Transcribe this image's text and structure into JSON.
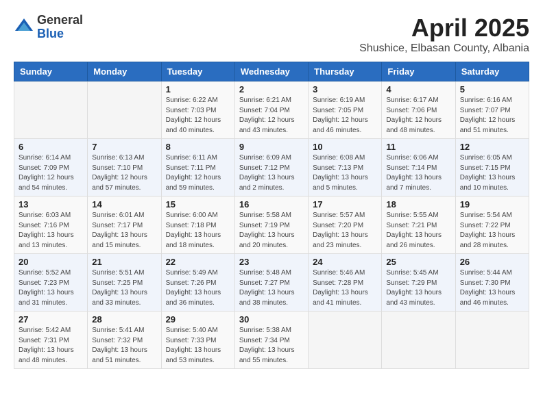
{
  "header": {
    "logo_general": "General",
    "logo_blue": "Blue",
    "month": "April 2025",
    "location": "Shushice, Elbasan County, Albania"
  },
  "weekdays": [
    "Sunday",
    "Monday",
    "Tuesday",
    "Wednesday",
    "Thursday",
    "Friday",
    "Saturday"
  ],
  "weeks": [
    [
      {
        "day": "",
        "info": ""
      },
      {
        "day": "",
        "info": ""
      },
      {
        "day": "1",
        "info": "Sunrise: 6:22 AM\nSunset: 7:03 PM\nDaylight: 12 hours and 40 minutes."
      },
      {
        "day": "2",
        "info": "Sunrise: 6:21 AM\nSunset: 7:04 PM\nDaylight: 12 hours and 43 minutes."
      },
      {
        "day": "3",
        "info": "Sunrise: 6:19 AM\nSunset: 7:05 PM\nDaylight: 12 hours and 46 minutes."
      },
      {
        "day": "4",
        "info": "Sunrise: 6:17 AM\nSunset: 7:06 PM\nDaylight: 12 hours and 48 minutes."
      },
      {
        "day": "5",
        "info": "Sunrise: 6:16 AM\nSunset: 7:07 PM\nDaylight: 12 hours and 51 minutes."
      }
    ],
    [
      {
        "day": "6",
        "info": "Sunrise: 6:14 AM\nSunset: 7:09 PM\nDaylight: 12 hours and 54 minutes."
      },
      {
        "day": "7",
        "info": "Sunrise: 6:13 AM\nSunset: 7:10 PM\nDaylight: 12 hours and 57 minutes."
      },
      {
        "day": "8",
        "info": "Sunrise: 6:11 AM\nSunset: 7:11 PM\nDaylight: 12 hours and 59 minutes."
      },
      {
        "day": "9",
        "info": "Sunrise: 6:09 AM\nSunset: 7:12 PM\nDaylight: 13 hours and 2 minutes."
      },
      {
        "day": "10",
        "info": "Sunrise: 6:08 AM\nSunset: 7:13 PM\nDaylight: 13 hours and 5 minutes."
      },
      {
        "day": "11",
        "info": "Sunrise: 6:06 AM\nSunset: 7:14 PM\nDaylight: 13 hours and 7 minutes."
      },
      {
        "day": "12",
        "info": "Sunrise: 6:05 AM\nSunset: 7:15 PM\nDaylight: 13 hours and 10 minutes."
      }
    ],
    [
      {
        "day": "13",
        "info": "Sunrise: 6:03 AM\nSunset: 7:16 PM\nDaylight: 13 hours and 13 minutes."
      },
      {
        "day": "14",
        "info": "Sunrise: 6:01 AM\nSunset: 7:17 PM\nDaylight: 13 hours and 15 minutes."
      },
      {
        "day": "15",
        "info": "Sunrise: 6:00 AM\nSunset: 7:18 PM\nDaylight: 13 hours and 18 minutes."
      },
      {
        "day": "16",
        "info": "Sunrise: 5:58 AM\nSunset: 7:19 PM\nDaylight: 13 hours and 20 minutes."
      },
      {
        "day": "17",
        "info": "Sunrise: 5:57 AM\nSunset: 7:20 PM\nDaylight: 13 hours and 23 minutes."
      },
      {
        "day": "18",
        "info": "Sunrise: 5:55 AM\nSunset: 7:21 PM\nDaylight: 13 hours and 26 minutes."
      },
      {
        "day": "19",
        "info": "Sunrise: 5:54 AM\nSunset: 7:22 PM\nDaylight: 13 hours and 28 minutes."
      }
    ],
    [
      {
        "day": "20",
        "info": "Sunrise: 5:52 AM\nSunset: 7:23 PM\nDaylight: 13 hours and 31 minutes."
      },
      {
        "day": "21",
        "info": "Sunrise: 5:51 AM\nSunset: 7:25 PM\nDaylight: 13 hours and 33 minutes."
      },
      {
        "day": "22",
        "info": "Sunrise: 5:49 AM\nSunset: 7:26 PM\nDaylight: 13 hours and 36 minutes."
      },
      {
        "day": "23",
        "info": "Sunrise: 5:48 AM\nSunset: 7:27 PM\nDaylight: 13 hours and 38 minutes."
      },
      {
        "day": "24",
        "info": "Sunrise: 5:46 AM\nSunset: 7:28 PM\nDaylight: 13 hours and 41 minutes."
      },
      {
        "day": "25",
        "info": "Sunrise: 5:45 AM\nSunset: 7:29 PM\nDaylight: 13 hours and 43 minutes."
      },
      {
        "day": "26",
        "info": "Sunrise: 5:44 AM\nSunset: 7:30 PM\nDaylight: 13 hours and 46 minutes."
      }
    ],
    [
      {
        "day": "27",
        "info": "Sunrise: 5:42 AM\nSunset: 7:31 PM\nDaylight: 13 hours and 48 minutes."
      },
      {
        "day": "28",
        "info": "Sunrise: 5:41 AM\nSunset: 7:32 PM\nDaylight: 13 hours and 51 minutes."
      },
      {
        "day": "29",
        "info": "Sunrise: 5:40 AM\nSunset: 7:33 PM\nDaylight: 13 hours and 53 minutes."
      },
      {
        "day": "30",
        "info": "Sunrise: 5:38 AM\nSunset: 7:34 PM\nDaylight: 13 hours and 55 minutes."
      },
      {
        "day": "",
        "info": ""
      },
      {
        "day": "",
        "info": ""
      },
      {
        "day": "",
        "info": ""
      }
    ]
  ]
}
